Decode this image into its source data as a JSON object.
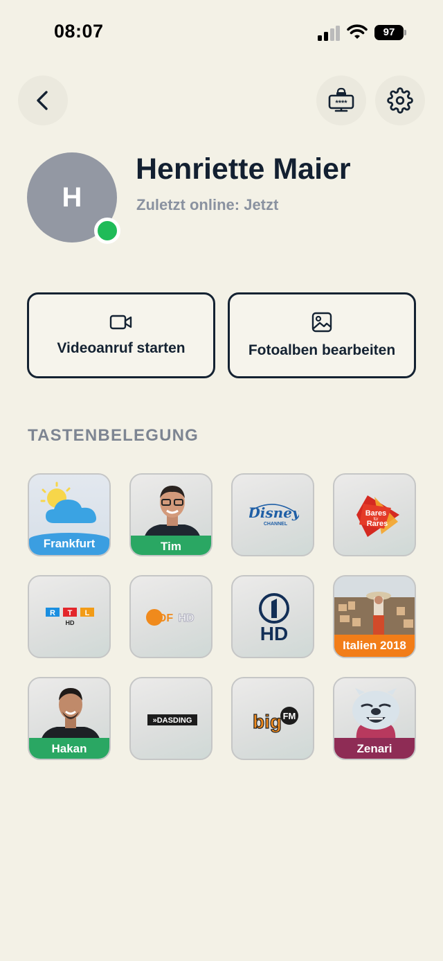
{
  "status_bar": {
    "time": "08:07",
    "battery": "97"
  },
  "profile": {
    "initial": "H",
    "name": "Henriette Maier",
    "status": "Zuletzt online: Jetzt",
    "online_color": "#1fbb58"
  },
  "actions": {
    "video": "Videoanruf starten",
    "albums": "Fotoalben bearbeiten"
  },
  "section": {
    "title": "TASTENBELEGUNG"
  },
  "tiles": [
    {
      "label": "Frankfurt",
      "icon": "weather-icon"
    },
    {
      "label": "Tim",
      "icon": "contact-photo"
    },
    {
      "label": "Disney Channel",
      "icon": "disney-channel-logo"
    },
    {
      "label": "Bares für Rares",
      "icon": "bares-fuer-rares-logo",
      "logo_text_1": "Bares",
      "logo_text_2": "für",
      "logo_text_3": "Rares"
    },
    {
      "label": "RTL HD",
      "icon": "rtl-logo",
      "logo_text_1": "R",
      "logo_text_2": "T",
      "logo_text_3": "L",
      "logo_text_4": "HD"
    },
    {
      "label": "ZDF HD",
      "icon": "zdf-logo",
      "logo_text_1": "2DF",
      "logo_text_2": "HD"
    },
    {
      "label": "Das Erste HD",
      "icon": "ard-logo",
      "logo_text_1": "HD"
    },
    {
      "label": "Italien 2018",
      "icon": "photo-album"
    },
    {
      "label": "Hakan",
      "icon": "contact-photo"
    },
    {
      "label": "DASDING",
      "icon": "dasding-logo",
      "logo_text_1": "»DASDING"
    },
    {
      "label": "bigFM",
      "icon": "bigfm-logo",
      "logo_text_1": "big",
      "logo_text_2": "FM"
    },
    {
      "label": "Zenari",
      "icon": "zenari-mascot"
    }
  ],
  "colors": {
    "background": "#f3f1e6",
    "text": "#142232",
    "muted": "#8a92a0"
  }
}
